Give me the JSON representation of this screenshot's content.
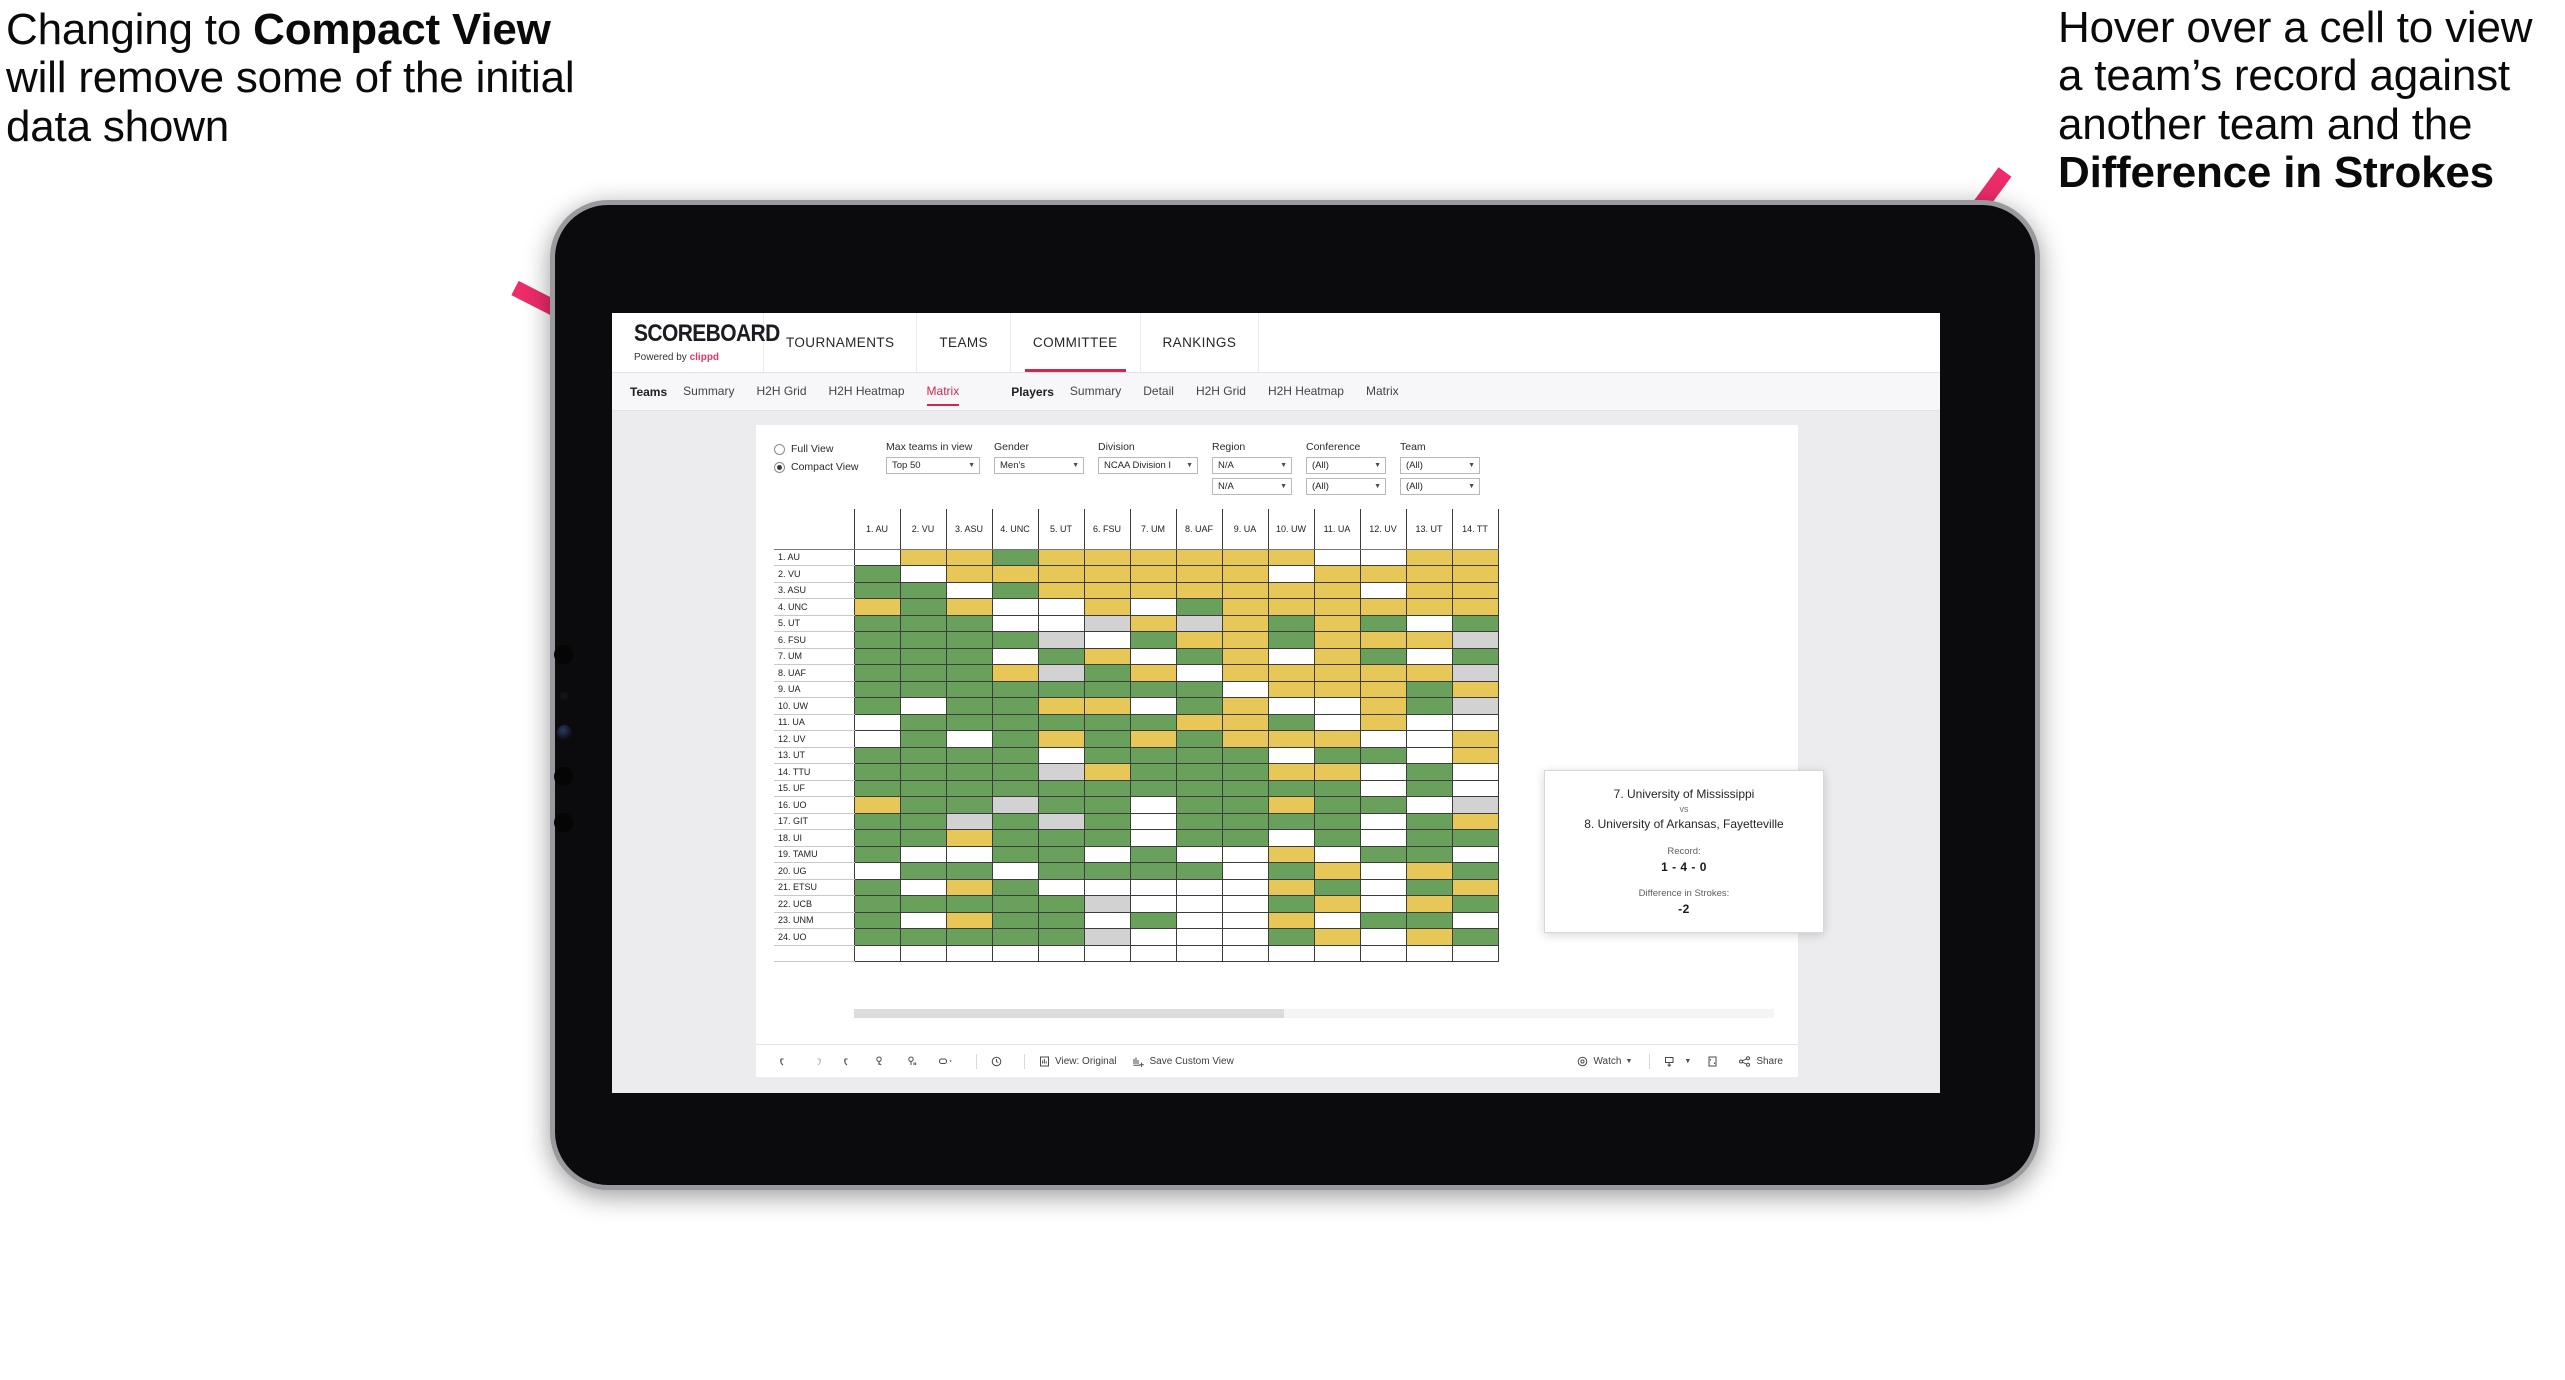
{
  "annotations": {
    "left": {
      "pre": "Changing to ",
      "bold": "Compact View",
      "post": " will remove some of the initial data shown"
    },
    "right": {
      "pre": "Hover over a cell to view a team’s record against another team and the ",
      "bold": "Difference in Strokes",
      "post": ""
    }
  },
  "app": {
    "logo": {
      "main": "SCOREBOARD",
      "powered": "Powered by ",
      "brand": "clippd"
    },
    "topnav": [
      {
        "label": "TOURNAMENTS",
        "active": false
      },
      {
        "label": "TEAMS",
        "active": false
      },
      {
        "label": "COMMITTEE",
        "active": true
      },
      {
        "label": "RANKINGS",
        "active": false
      }
    ],
    "subnav": {
      "teams_head": "Teams",
      "teams_items": [
        {
          "label": "Summary",
          "active": false
        },
        {
          "label": "H2H Grid",
          "active": false
        },
        {
          "label": "H2H Heatmap",
          "active": false
        },
        {
          "label": "Matrix",
          "active": true
        }
      ],
      "players_head": "Players",
      "players_items": [
        {
          "label": "Summary",
          "active": false
        },
        {
          "label": "Detail",
          "active": false
        },
        {
          "label": "H2H Grid",
          "active": false
        },
        {
          "label": "H2H Heatmap",
          "active": false
        },
        {
          "label": "Matrix",
          "active": false
        }
      ]
    },
    "filters": {
      "view_mode": {
        "full": "Full View",
        "compact": "Compact View",
        "selected": "Compact View"
      },
      "max_teams": {
        "label": "Max teams in view",
        "value": "Top 50"
      },
      "gender": {
        "label": "Gender",
        "value": "Men's"
      },
      "division": {
        "label": "Division",
        "value": "NCAA Division I"
      },
      "region": {
        "label": "Region",
        "value1": "N/A",
        "value2": "N/A"
      },
      "conference": {
        "label": "Conference",
        "value1": "(All)",
        "value2": "(All)"
      },
      "team": {
        "label": "Team",
        "value1": "(All)",
        "value2": "(All)"
      }
    },
    "tooltip": {
      "team_a": "7. University of Mississippi",
      "vs": "vs",
      "team_b": "8. University of Arkansas, Fayetteville",
      "record_label": "Record:",
      "record_value": "1 - 4 - 0",
      "strokes_label": "Difference in Strokes:",
      "strokes_value": "-2"
    },
    "toolbar": {
      "undo": "undo-icon",
      "redo": "redo-icon",
      "revert": "revert-icon",
      "refresh": "refresh-icon",
      "pause": "pause-icon",
      "highlight": "highlight-icon",
      "history": "history-icon",
      "view_original": "View: Original",
      "save_custom_view": "Save Custom View",
      "watch": "Watch",
      "download": "download-icon",
      "fullscreen": "fullscreen-icon",
      "share": "Share"
    }
  },
  "chart_data": {
    "type": "heatmap",
    "title": "Head-to-Head Team Matrix",
    "legend": {
      "win": "#68a05c",
      "loss": "#e6c758",
      "tie": "#d2d2d3",
      "none": "#ffffff"
    },
    "columns": [
      "1. AU",
      "2. VU",
      "3. ASU",
      "4. UNC",
      "5. UT",
      "6. FSU",
      "7. UM",
      "8. UAF",
      "9. UA",
      "10. UW",
      "11. UA",
      "12. UV",
      "13. UT",
      "14. TT"
    ],
    "rows": [
      "1. AU",
      "2. VU",
      "3. ASU",
      "4. UNC",
      "5. UT",
      "6. FSU",
      "7. UM",
      "8. UAF",
      "9. UA",
      "10. UW",
      "11. UA",
      "12. UV",
      "13. UT",
      "14. TTU",
      "15. UF",
      "16. UO",
      "17. GIT",
      "18. UI",
      "19. TAMU",
      "20. UG",
      "21. ETSU",
      "22. UCB",
      "23. UNM",
      "24. UO"
    ],
    "cells": [
      [
        "w",
        "y",
        "y",
        "g",
        "y",
        "y",
        "y",
        "y",
        "y",
        "y",
        "w",
        "w",
        "y",
        "y"
      ],
      [
        "g",
        "w",
        "y",
        "y",
        "y",
        "y",
        "y",
        "y",
        "y",
        "w",
        "y",
        "y",
        "y",
        "y"
      ],
      [
        "g",
        "g",
        "w",
        "g",
        "y",
        "y",
        "y",
        "y",
        "y",
        "y",
        "y",
        "w",
        "y",
        "y"
      ],
      [
        "y",
        "g",
        "y",
        "w",
        "w",
        "y",
        "w",
        "g",
        "y",
        "y",
        "y",
        "y",
        "y",
        "y"
      ],
      [
        "g",
        "g",
        "g",
        "w",
        "w",
        "a",
        "y",
        "a",
        "y",
        "g",
        "y",
        "g",
        "w",
        "g"
      ],
      [
        "g",
        "g",
        "g",
        "g",
        "a",
        "w",
        "g",
        "y",
        "y",
        "g",
        "y",
        "y",
        "y",
        "a"
      ],
      [
        "g",
        "g",
        "g",
        "w",
        "g",
        "y",
        "w",
        "g",
        "y",
        "w",
        "y",
        "g",
        "w",
        "g"
      ],
      [
        "g",
        "g",
        "g",
        "y",
        "a",
        "g",
        "y",
        "w",
        "y",
        "y",
        "y",
        "y",
        "y",
        "a"
      ],
      [
        "g",
        "g",
        "g",
        "g",
        "g",
        "g",
        "g",
        "g",
        "w",
        "y",
        "y",
        "y",
        "g",
        "y"
      ],
      [
        "g",
        "w",
        "g",
        "g",
        "y",
        "y",
        "w",
        "g",
        "y",
        "w",
        "w",
        "y",
        "g",
        "a"
      ],
      [
        "w",
        "g",
        "g",
        "g",
        "g",
        "g",
        "g",
        "y",
        "y",
        "g",
        "w",
        "y",
        "w",
        "w"
      ],
      [
        "w",
        "g",
        "w",
        "g",
        "y",
        "g",
        "y",
        "g",
        "y",
        "y",
        "y",
        "w",
        "w",
        "y"
      ],
      [
        "g",
        "g",
        "g",
        "g",
        "w",
        "g",
        "g",
        "g",
        "g",
        "w",
        "g",
        "g",
        "w",
        "y"
      ],
      [
        "g",
        "g",
        "g",
        "g",
        "a",
        "y",
        "g",
        "g",
        "g",
        "y",
        "y",
        "w",
        "g",
        "w"
      ],
      [
        "g",
        "g",
        "g",
        "g",
        "g",
        "g",
        "g",
        "g",
        "g",
        "g",
        "g",
        "w",
        "g",
        "w"
      ],
      [
        "y",
        "g",
        "g",
        "a",
        "g",
        "g",
        "w",
        "g",
        "g",
        "y",
        "g",
        "g",
        "w",
        "a"
      ],
      [
        "g",
        "g",
        "a",
        "g",
        "a",
        "g",
        "w",
        "g",
        "g",
        "g",
        "g",
        "w",
        "g",
        "y"
      ],
      [
        "g",
        "g",
        "y",
        "g",
        "g",
        "g",
        "w",
        "g",
        "g",
        "w",
        "g",
        "w",
        "g",
        "g"
      ],
      [
        "g",
        "w",
        "w",
        "g",
        "g",
        "w",
        "g",
        "w",
        "w",
        "y",
        "w",
        "g",
        "g",
        "w"
      ],
      [
        "w",
        "g",
        "g",
        "w",
        "g",
        "g",
        "g",
        "g",
        "w",
        "g",
        "y",
        "w",
        "y",
        "g"
      ],
      [
        "g",
        "w",
        "y",
        "g",
        "w",
        "w",
        "w",
        "w",
        "w",
        "y",
        "g",
        "w",
        "g",
        "y"
      ],
      [
        "g",
        "g",
        "g",
        "g",
        "g",
        "a",
        "w",
        "w",
        "w",
        "g",
        "y",
        "w",
        "y",
        "g"
      ],
      [
        "g",
        "w",
        "y",
        "g",
        "g",
        "w",
        "g",
        "w",
        "w",
        "y",
        "w",
        "g",
        "g",
        "w"
      ],
      [
        "g",
        "g",
        "g",
        "g",
        "g",
        "a",
        "w",
        "w",
        "w",
        "g",
        "y",
        "w",
        "y",
        "g"
      ]
    ]
  }
}
